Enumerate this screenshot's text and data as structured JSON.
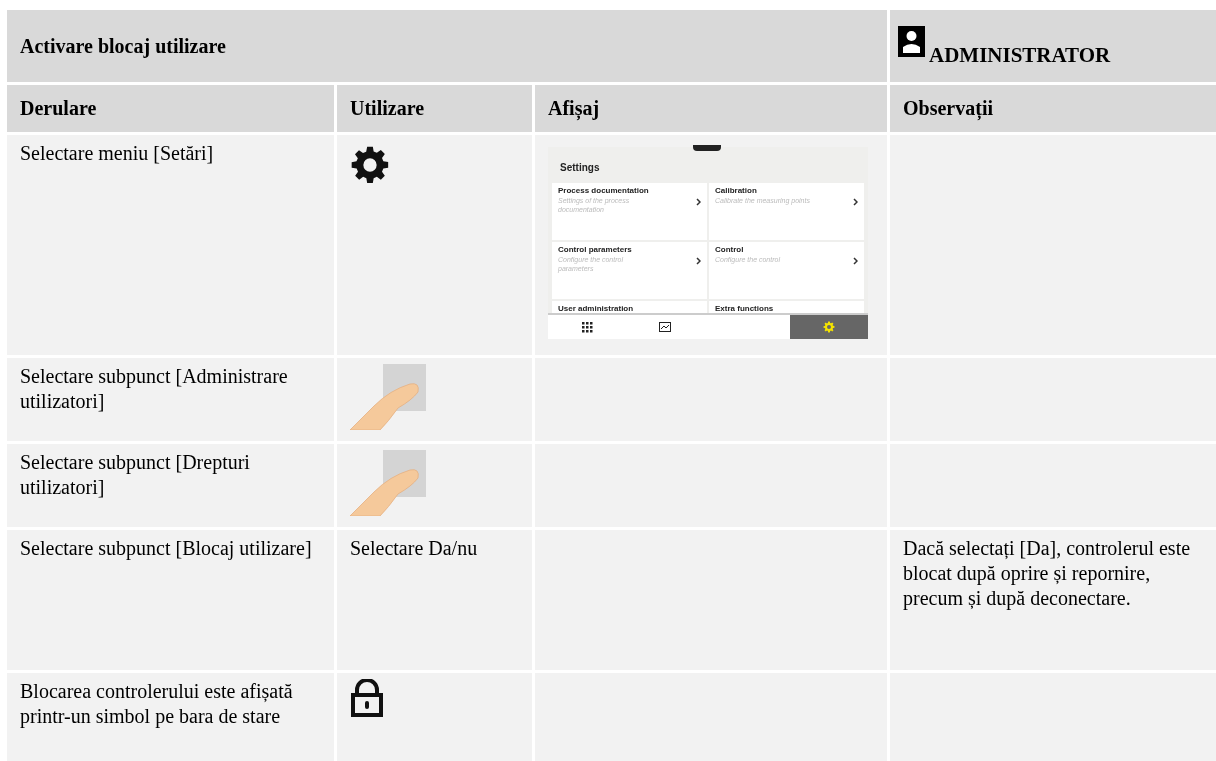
{
  "title": "Activare blocaj utilizare",
  "role": "ADMINISTRATOR",
  "columns": [
    "Derulare",
    "Utilizare",
    "Afișaj",
    "Observații"
  ],
  "rows": [
    {
      "step": "Selectare meniu [Setări]",
      "operation": {
        "kind": "gear"
      },
      "display": {
        "title": "Settings",
        "tiles": [
          {
            "title": "Process documentation",
            "subtitle": "Settings of the process documentation"
          },
          {
            "title": "Calibration",
            "subtitle": "Calibrate the measuring points"
          },
          {
            "title": "Control parameters",
            "subtitle": "Configure the control parameters"
          },
          {
            "title": "Control",
            "subtitle": "Configure the control"
          },
          {
            "title": "User administration"
          },
          {
            "title": "Extra functions"
          }
        ],
        "nav": [
          {
            "kind": "grid",
            "selected": false
          },
          {
            "kind": "chart",
            "selected": false
          },
          {
            "kind": "gear",
            "selected": true
          }
        ]
      }
    },
    {
      "step": "Selectare subpunct [Administrare utilizatori]",
      "operation": {
        "kind": "touch"
      }
    },
    {
      "step": "Selectare subpunct [Drepturi utilizatori]",
      "operation": {
        "kind": "touch"
      }
    },
    {
      "step": "Selectare subpunct [Blocaj utilizare]",
      "operation": {
        "kind": "text",
        "text": "Selectare Da/nu"
      },
      "note": "Dacă selectați [Da], controlerul este blocat după oprire și repornire, precum și după deconectare."
    },
    {
      "step": "Blocarea controlerului este afișată printr-un simbol pe bara de stare",
      "operation": {
        "kind": "lock"
      }
    }
  ]
}
